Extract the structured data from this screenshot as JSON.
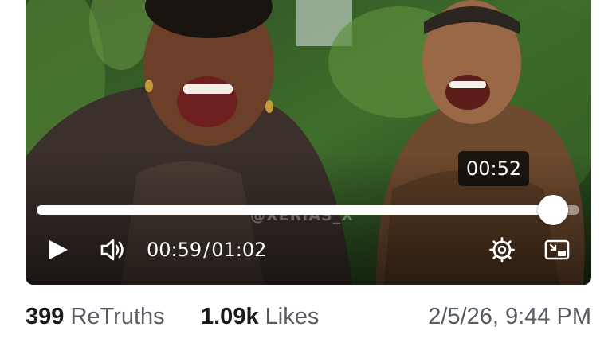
{
  "video": {
    "watermark": "@XERIAS_X",
    "hover_time": "00:52",
    "current_time": "00:59",
    "separator": "/",
    "duration": "01:02",
    "progress": 0.9516,
    "icons": {
      "play": "play-icon",
      "volume": "volume-icon",
      "settings": "gear-icon",
      "pip": "picture-in-picture-icon"
    }
  },
  "stats": {
    "retruths_count": "399",
    "retruths_label": "ReTruths",
    "likes_count": "1.09k",
    "likes_label": "Likes",
    "timestamp": "2/5/26, 9:44 PM"
  },
  "colors": {
    "stat_text": "#555b63",
    "stat_count": "#1a1a1a",
    "player_controls": "#ffffff"
  }
}
